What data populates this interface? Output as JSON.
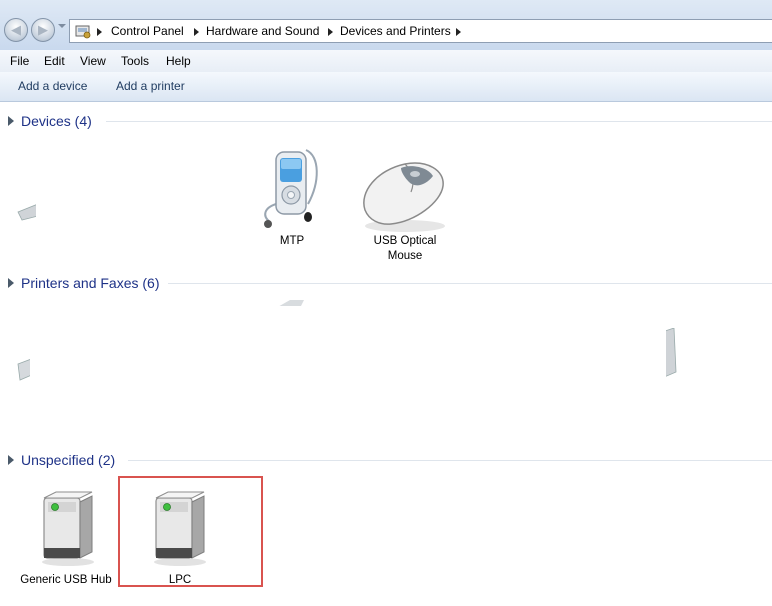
{
  "address_bar": {
    "breadcrumbs": [
      "Control Panel",
      "Hardware and Sound",
      "Devices and Printers"
    ]
  },
  "menu": {
    "items": [
      "File",
      "Edit",
      "View",
      "Tools",
      "Help"
    ]
  },
  "commands": {
    "add_device": "Add a device",
    "add_printer": "Add a printer"
  },
  "groups": {
    "devices": {
      "title": "Devices (4)",
      "items": [
        {
          "label": "MTP",
          "icon": "media-player-icon"
        },
        {
          "label": "USB Optical Mouse",
          "icon": "mouse-icon"
        }
      ]
    },
    "printers": {
      "title": "Printers and Faxes (6)"
    },
    "unspecified": {
      "title": "Unspecified (2)",
      "items": [
        {
          "label": "Generic USB Hub",
          "icon": "usb-hub-icon"
        },
        {
          "label": "LPC",
          "icon": "usb-hub-icon"
        }
      ]
    }
  },
  "colors": {
    "group_title": "#1e3287",
    "selection_outline": "#d9534f",
    "device_led": "#3fbf3f"
  }
}
